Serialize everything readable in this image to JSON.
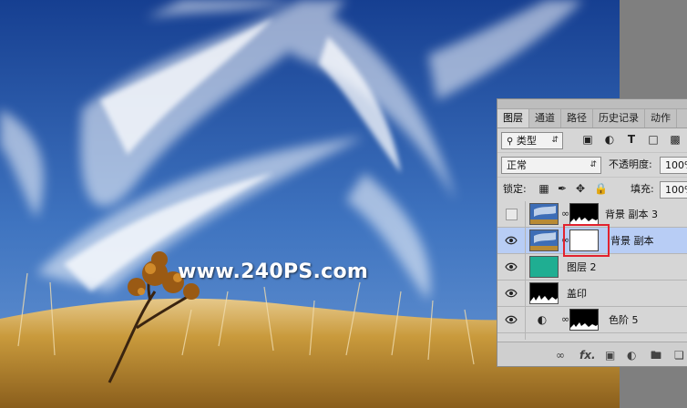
{
  "watermark": "www.240PS.com",
  "panel": {
    "tabs": [
      "图层",
      "通道",
      "路径",
      "历史记录",
      "动作"
    ],
    "active_tab": "图层",
    "filter_select": "类型",
    "blend_mode": "正常",
    "opacity_label": "不透明度:",
    "opacity_value": "100%",
    "lock_label": "锁定:",
    "fill_label": "填充:",
    "fill_value": "100%",
    "layers": [
      {
        "name": "背景 副本 3",
        "visible": false,
        "thumb": "photo",
        "mask": "black-grass"
      },
      {
        "name": "背景 副本",
        "visible": true,
        "selected": true,
        "thumb": "photo",
        "mask": "white"
      },
      {
        "name": "图层 2",
        "visible": true,
        "thumb": "teal"
      },
      {
        "name": "盖印",
        "visible": true,
        "thumb": "black-grass"
      },
      {
        "name": "色阶 5",
        "visible": true,
        "adjustment": true,
        "mask": "black-grass"
      }
    ],
    "bottom_icons": [
      "link-icon",
      "fx-icon",
      "mask-icon",
      "adjustment-icon",
      "folder-icon",
      "new-layer-icon"
    ],
    "bottom_fx": "fx."
  },
  "colors": {
    "sky_top": "#1c4a9c",
    "sky_bottom": "#5d8fd0",
    "grass": "#c89a3a",
    "teal": "#1fae92",
    "selected_row": "#b8cdf5",
    "highlight": "#e2222e"
  }
}
